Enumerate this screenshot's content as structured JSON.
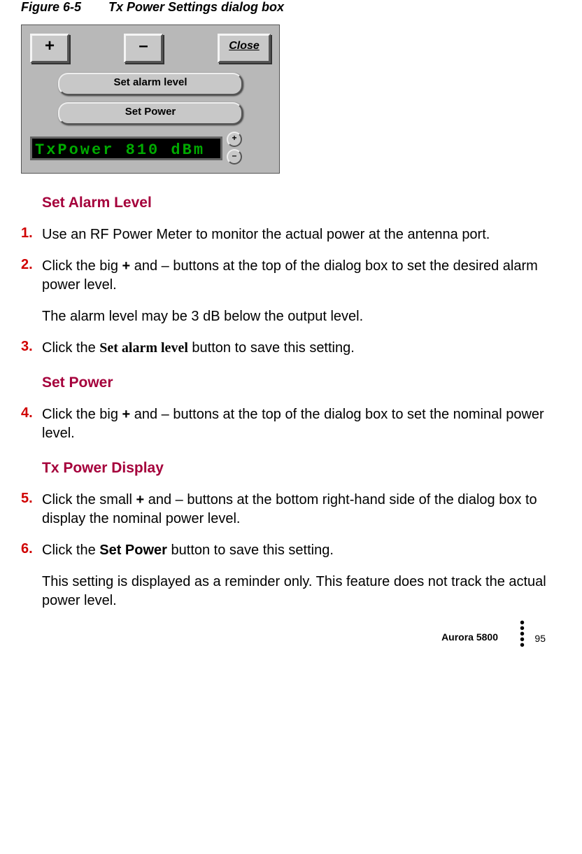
{
  "figure": {
    "num": "Figure 6-5",
    "title": "Tx Power Settings dialog box"
  },
  "dialog": {
    "plus": "+",
    "minus": "–",
    "close": "Close",
    "set_alarm_level": "Set alarm level",
    "set_power": "Set Power",
    "display": "TxPower 810 dBm",
    "mini_plus": "+",
    "mini_minus": "–"
  },
  "headings": {
    "set_alarm_level": "Set Alarm Level",
    "set_power": "Set Power",
    "tx_power_display": "Tx Power Display"
  },
  "steps": {
    "s1": {
      "num": "1.",
      "t1": "Use an RF Power Meter to monitor the actual power at the antenna port."
    },
    "s2": {
      "num": "2.",
      "pre": "Click the big ",
      "plus": "+",
      "mid": " and ",
      "minus": "–",
      "post": " buttons at the top of the dialog box to set the desired alarm power level."
    },
    "s2note": "The alarm level may be 3 dB below the output level.",
    "s3": {
      "num": "3.",
      "pre": "Click the ",
      "bold": "Set alarm level",
      "post": " button to save this setting."
    },
    "s4": {
      "num": "4.",
      "pre": "Click the big ",
      "plus": "+",
      "mid": " and ",
      "minus": "–",
      "post": " buttons at the top of the dialog box to set the nominal power level."
    },
    "s5": {
      "num": "5.",
      "pre": "Click the small ",
      "plus": "+",
      "mid": " and ",
      "minus": "–",
      "post": " buttons at the bottom right-hand side of the dialog box to display the nominal power level."
    },
    "s6": {
      "num": "6.",
      "pre": "Click the ",
      "bold": "Set Power",
      "post": " button to save this setting."
    },
    "s6note": "This setting is displayed as a reminder only. This feature does not track the actual power level."
  },
  "footer": {
    "product": "Aurora 5800",
    "page": "95"
  }
}
